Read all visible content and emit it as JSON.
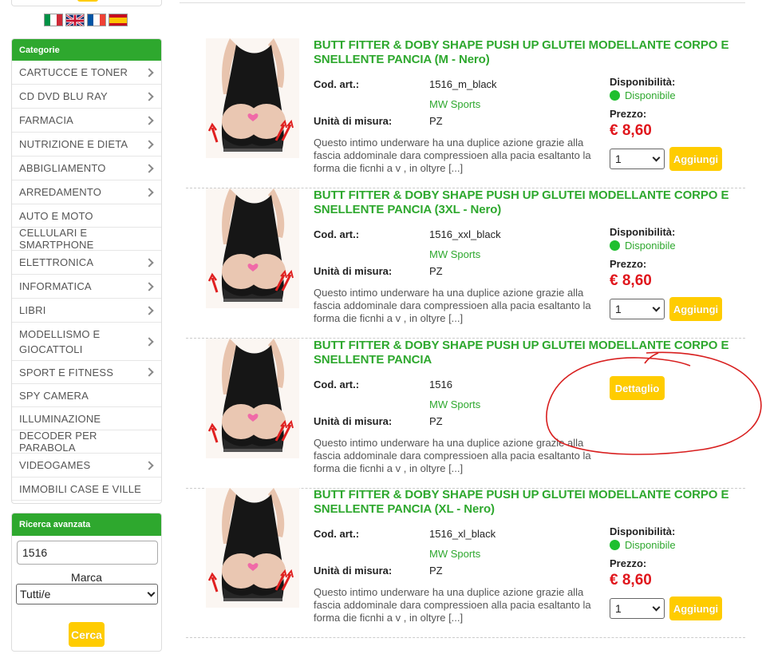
{
  "sidebar": {
    "categories_title": "Categorie",
    "categories": [
      {
        "label": "CARTUCCE E TONER",
        "has_sub": true
      },
      {
        "label": "CD DVD BLU RAY",
        "has_sub": true
      },
      {
        "label": "FARMACIA",
        "has_sub": true
      },
      {
        "label": "NUTRIZIONE E DIETA",
        "has_sub": true
      },
      {
        "label": "ABBIGLIAMENTO",
        "has_sub": true
      },
      {
        "label": "ARREDAMENTO",
        "has_sub": true
      },
      {
        "label": "AUTO E MOTO",
        "has_sub": false
      },
      {
        "label": "CELLULARI E SMARTPHONE",
        "has_sub": false
      },
      {
        "label": "ELETTRONICA",
        "has_sub": true
      },
      {
        "label": "INFORMATICA",
        "has_sub": true
      },
      {
        "label": "LIBRI",
        "has_sub": true
      },
      {
        "label": "MODELLISMO E GIOCATTOLI",
        "has_sub": true
      },
      {
        "label": "SPORT E FITNESS",
        "has_sub": true
      },
      {
        "label": "SPY CAMERA",
        "has_sub": false
      },
      {
        "label": "ILLUMINAZIONE",
        "has_sub": false
      },
      {
        "label": "DECODER PER PARABOLA",
        "has_sub": false
      },
      {
        "label": "VIDEOGAMES",
        "has_sub": true
      },
      {
        "label": "IMMOBILI CASE E VILLE",
        "has_sub": false
      }
    ],
    "search_title": "Ricerca avanzata",
    "search_value": "1516",
    "brand_label": "Marca",
    "brand_selected": "Tutti/e",
    "search_button": "Cerca"
  },
  "flags": [
    {
      "name": "flag-italy-icon",
      "colors": [
        "#009246",
        "#ffffff",
        "#ce2b37"
      ]
    },
    {
      "name": "flag-uk-icon",
      "colors": [
        "#012169",
        "#ffffff",
        "#c8102e"
      ]
    },
    {
      "name": "flag-france-icon",
      "colors": [
        "#0055a4",
        "#ffffff",
        "#ef4135"
      ]
    },
    {
      "name": "flag-spain-icon",
      "colors": [
        "#c60b1e",
        "#ffc400",
        "#c60b1e"
      ]
    }
  ],
  "labels": {
    "code": "Cod. art.:",
    "unit": "Unità di misura:",
    "availability": "Disponibilità:",
    "price": "Prezzo:",
    "add": "Aggiungi",
    "detail": "Dettaglio"
  },
  "products": [
    {
      "title": "BUTT FITTER & DOBY SHAPE PUSH UP GLUTEI MODELLANTE CORPO E SNELLENTE PANCIA (M - Nero)",
      "code": "1516_m_black",
      "brand": "MW Sports",
      "unit": "PZ",
      "description": "Questo intimo underware ha una duplice azione grazie alla fascia addominale dara compressioen alla pacia esaltanto la forma die ficnhi a v , in oltyre [...]",
      "availability": "Disponibile",
      "price": "€ 8,60",
      "qty": "1"
    },
    {
      "title": "BUTT FITTER & DOBY SHAPE PUSH UP GLUTEI MODELLANTE CORPO E SNELLENTE PANCIA (3XL - Nero)",
      "code": "1516_xxl_black",
      "brand": "MW Sports",
      "unit": "PZ",
      "description": "Questo intimo underware ha una duplice azione grazie alla fascia addominale dara compressioen alla pacia esaltanto la forma die ficnhi a v , in oltyre [...]",
      "availability": "Disponibile",
      "price": "€ 8,60",
      "qty": "1"
    },
    {
      "title": "BUTT FITTER & DOBY SHAPE PUSH UP GLUTEI MODELLANTE CORPO E SNELLENTE PANCIA",
      "code": "1516",
      "brand": "MW Sports",
      "unit": "PZ",
      "description": "Questo intimo underware ha una duplice azione grazie alla fascia addominale dara compressioen alla pacia esaltanto la forma die ficnhi a v , in oltyre [...]"
    },
    {
      "title": "BUTT FITTER & DOBY SHAPE PUSH UP GLUTEI MODELLANTE CORPO E SNELLENTE PANCIA (XL - Nero)",
      "code": "1516_xl_black",
      "brand": "MW Sports",
      "unit": "PZ",
      "description": "Questo intimo underware ha una duplice azione grazie alla fascia addominale dara compressioen alla pacia esaltanto la forma die ficnhi a v , in oltyre [...]",
      "availability": "Disponibile",
      "price": "€ 8,60",
      "qty": "1"
    }
  ],
  "colors": {
    "accent_green": "#2ea82e",
    "button_yellow": "#ffcc00",
    "price_red": "#e0161c",
    "annotation_red": "#d81f1f"
  }
}
